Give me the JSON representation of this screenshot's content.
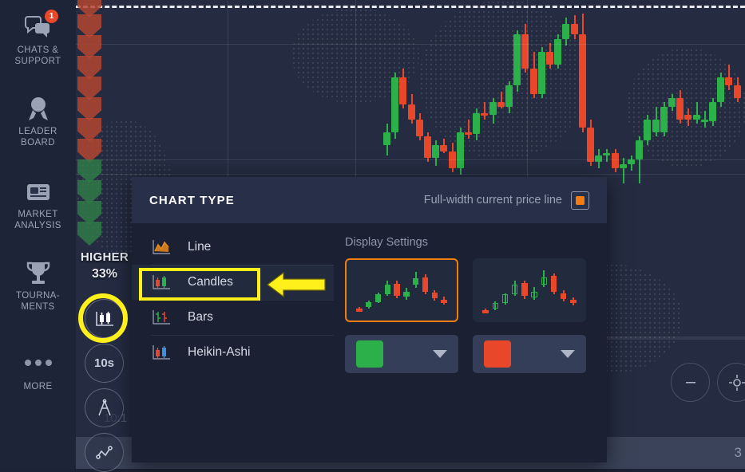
{
  "left_rail": {
    "items": [
      {
        "name": "chats-support",
        "label": "CHATS &\nSUPPORT",
        "label1": "CHATS &",
        "label2": "SUPPORT",
        "icon": "chat-bubbles-icon",
        "badge": "1"
      },
      {
        "name": "leader-board",
        "label1": "LEADER",
        "label2": "BOARD",
        "icon": "medal-icon",
        "badge": ""
      },
      {
        "name": "market-analysis",
        "label1": "MARKET",
        "label2": "ANALYSIS",
        "icon": "news-icon",
        "badge": ""
      },
      {
        "name": "tournaments",
        "label1": "TOURNA-",
        "label2": "MENTS",
        "icon": "trophy-icon",
        "badge": ""
      },
      {
        "name": "more",
        "label1": "MORE",
        "label2": "",
        "icon": "ellipsis-icon",
        "badge": ""
      }
    ]
  },
  "trade_column": {
    "direction_label": "HIGHER",
    "payout_percent": "33%",
    "chart_type_button": "candles-icon",
    "timeframe_button": "10s",
    "drawing_button": "compass-icon",
    "indicators_button": "indicator-icon",
    "ghost_time": "10:1"
  },
  "panel": {
    "title": "CHART TYPE",
    "full_width_price_line_label": "Full-width current price line",
    "full_width_price_line_on": true,
    "types": [
      {
        "id": "line",
        "label": "Line",
        "icon": "line-chart-icon",
        "selected": false
      },
      {
        "id": "candles",
        "label": "Candles",
        "icon": "candles-icon",
        "selected": true
      },
      {
        "id": "bars",
        "label": "Bars",
        "icon": "bars-chart-icon",
        "selected": false
      },
      {
        "id": "heikin-ashi",
        "label": "Heikin-Ashi",
        "icon": "heikin-ashi-icon",
        "selected": false
      }
    ],
    "display_settings": {
      "title": "Display Settings",
      "styles": [
        {
          "id": "filled",
          "selected": true
        },
        {
          "id": "hollow",
          "selected": false
        }
      ],
      "up_color": "#2bb04a",
      "down_color": "#e8472a"
    }
  },
  "annotations": {
    "highlight_target": "Candles",
    "arrow_direction": "left",
    "highlight_color": "#ffef1a",
    "ring_target": "chart-type-button"
  },
  "bottom_bar": {
    "value": "3"
  },
  "colors": {
    "accent_orange": "#ef7d12",
    "up_green": "#2bb04a",
    "down_red": "#e8472a",
    "panel_bg": "#1b2132",
    "panel_header_bg": "#283049",
    "chart_bg": "#252c42",
    "rail_bg": "#1d2437",
    "badge_red": "#e8472a"
  },
  "chart_data": {
    "type": "candlestick",
    "title": "",
    "grid": true,
    "current_price_line": "dashed white at top",
    "candles": [
      {
        "o": 38,
        "h": 48,
        "l": 33,
        "c": 44,
        "dir": "up"
      },
      {
        "o": 44,
        "h": 72,
        "l": 41,
        "c": 70,
        "dir": "up"
      },
      {
        "o": 70,
        "h": 74,
        "l": 55,
        "c": 57,
        "dir": "down"
      },
      {
        "o": 57,
        "h": 62,
        "l": 48,
        "c": 50,
        "dir": "down"
      },
      {
        "o": 50,
        "h": 53,
        "l": 40,
        "c": 42,
        "dir": "down"
      },
      {
        "o": 42,
        "h": 44,
        "l": 30,
        "c": 32,
        "dir": "down"
      },
      {
        "o": 32,
        "h": 40,
        "l": 28,
        "c": 38,
        "dir": "up"
      },
      {
        "o": 38,
        "h": 41,
        "l": 34,
        "c": 35,
        "dir": "down"
      },
      {
        "o": 35,
        "h": 39,
        "l": 25,
        "c": 27,
        "dir": "down"
      },
      {
        "o": 27,
        "h": 46,
        "l": 24,
        "c": 44,
        "dir": "up"
      },
      {
        "o": 44,
        "h": 50,
        "l": 41,
        "c": 43,
        "dir": "down"
      },
      {
        "o": 43,
        "h": 55,
        "l": 40,
        "c": 53,
        "dir": "up"
      },
      {
        "o": 53,
        "h": 58,
        "l": 50,
        "c": 52,
        "dir": "down"
      },
      {
        "o": 52,
        "h": 60,
        "l": 48,
        "c": 58,
        "dir": "up"
      },
      {
        "o": 58,
        "h": 63,
        "l": 55,
        "c": 56,
        "dir": "down"
      },
      {
        "o": 56,
        "h": 68,
        "l": 53,
        "c": 66,
        "dir": "up"
      },
      {
        "o": 66,
        "h": 92,
        "l": 63,
        "c": 90,
        "dir": "up"
      },
      {
        "o": 90,
        "h": 95,
        "l": 72,
        "c": 74,
        "dir": "down"
      },
      {
        "o": 74,
        "h": 82,
        "l": 60,
        "c": 62,
        "dir": "down"
      },
      {
        "o": 62,
        "h": 84,
        "l": 60,
        "c": 82,
        "dir": "up"
      },
      {
        "o": 82,
        "h": 86,
        "l": 74,
        "c": 76,
        "dir": "down"
      },
      {
        "o": 76,
        "h": 90,
        "l": 74,
        "c": 88,
        "dir": "up"
      },
      {
        "o": 88,
        "h": 98,
        "l": 85,
        "c": 95,
        "dir": "up"
      },
      {
        "o": 95,
        "h": 99,
        "l": 88,
        "c": 90,
        "dir": "down"
      },
      {
        "o": 90,
        "h": 100,
        "l": 44,
        "c": 46,
        "dir": "down"
      },
      {
        "o": 46,
        "h": 50,
        "l": 28,
        "c": 30,
        "dir": "down"
      },
      {
        "o": 30,
        "h": 36,
        "l": 27,
        "c": 33,
        "dir": "up"
      },
      {
        "o": 33,
        "h": 36,
        "l": 30,
        "c": 34,
        "dir": "up"
      },
      {
        "o": 34,
        "h": 36,
        "l": 25,
        "c": 27,
        "dir": "down"
      },
      {
        "o": 27,
        "h": 32,
        "l": 20,
        "c": 29,
        "dir": "up"
      },
      {
        "o": 29,
        "h": 33,
        "l": 26,
        "c": 31,
        "dir": "up"
      },
      {
        "o": 31,
        "h": 42,
        "l": 20,
        "c": 40,
        "dir": "up"
      },
      {
        "o": 40,
        "h": 52,
        "l": 38,
        "c": 50,
        "dir": "up"
      },
      {
        "o": 50,
        "h": 56,
        "l": 42,
        "c": 44,
        "dir": "up"
      },
      {
        "o": 44,
        "h": 58,
        "l": 42,
        "c": 56,
        "dir": "up"
      },
      {
        "o": 56,
        "h": 62,
        "l": 54,
        "c": 60,
        "dir": "up"
      },
      {
        "o": 60,
        "h": 64,
        "l": 48,
        "c": 50,
        "dir": "down"
      },
      {
        "o": 50,
        "h": 55,
        "l": 47,
        "c": 52,
        "dir": "down"
      },
      {
        "o": 52,
        "h": 58,
        "l": 48,
        "c": 50,
        "dir": "up"
      },
      {
        "o": 50,
        "h": 54,
        "l": 46,
        "c": 49,
        "dir": "up"
      },
      {
        "o": 49,
        "h": 60,
        "l": 47,
        "c": 58,
        "dir": "up"
      },
      {
        "o": 58,
        "h": 72,
        "l": 56,
        "c": 70,
        "dir": "up"
      },
      {
        "o": 70,
        "h": 76,
        "l": 64,
        "c": 66,
        "dir": "down"
      },
      {
        "o": 66,
        "h": 70,
        "l": 58,
        "c": 60,
        "dir": "down"
      }
    ]
  }
}
